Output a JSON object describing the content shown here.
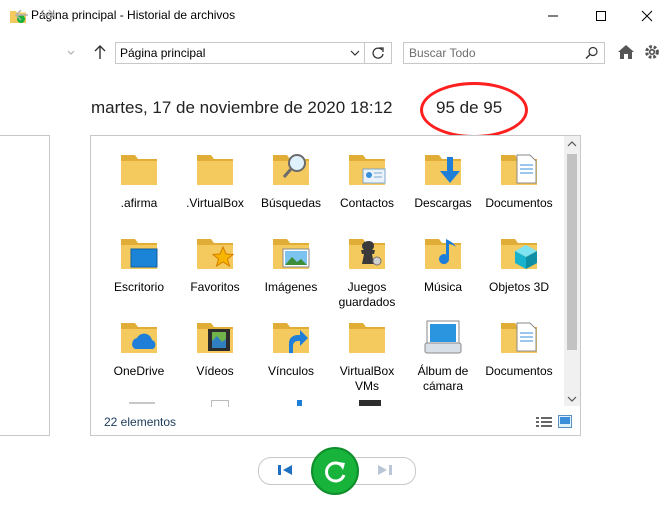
{
  "window": {
    "title": "Página principal - Historial de archivos"
  },
  "navigation": {
    "address": "Página principal",
    "search_placeholder": "Buscar Todo"
  },
  "header": {
    "date": "martes, 17 de noviembre de 2020 18:12",
    "count": "95 de 95"
  },
  "items": [
    {
      "label": "afirma",
      "prefix": ".",
      "icon": "folder-icon"
    },
    {
      "label": ".VirtualBox",
      "icon": "folder-icon"
    },
    {
      "label": "Búsquedas",
      "icon": "search-folder-icon"
    },
    {
      "label": "Contactos",
      "icon": "contacts-folder-icon"
    },
    {
      "label": "Descargas",
      "icon": "downloads-folder-icon"
    },
    {
      "label": "Documentos",
      "icon": "documents-folder-icon"
    },
    {
      "label": "Escritorio",
      "icon": "desktop-folder-icon"
    },
    {
      "label": "Favoritos",
      "icon": "favorites-folder-icon"
    },
    {
      "label": "Imágenes",
      "icon": "pictures-folder-icon"
    },
    {
      "label": "Juegos guardados",
      "icon": "saved-games-folder-icon"
    },
    {
      "label": "Música",
      "icon": "music-folder-icon"
    },
    {
      "label": "Objetos 3D",
      "icon": "3d-objects-folder-icon"
    },
    {
      "label": "OneDrive",
      "icon": "onedrive-folder-icon"
    },
    {
      "label": "Vídeos",
      "icon": "videos-folder-icon"
    },
    {
      "label": "Vínculos",
      "icon": "links-folder-icon"
    },
    {
      "label": "VirtualBox VMs",
      "icon": "folder-icon"
    },
    {
      "label": "Álbum de cámara",
      "icon": "camera-roll-icon"
    },
    {
      "label": "Documentos",
      "icon": "documents-folder-icon"
    }
  ],
  "status": {
    "text": "22 elementos"
  },
  "colors": {
    "folder": "#f4c95d",
    "folder_dark": "#e0ad36",
    "accent": "#0078d7",
    "highlight_circle": "#ff1f1f",
    "restore_button": "#17b33b"
  }
}
